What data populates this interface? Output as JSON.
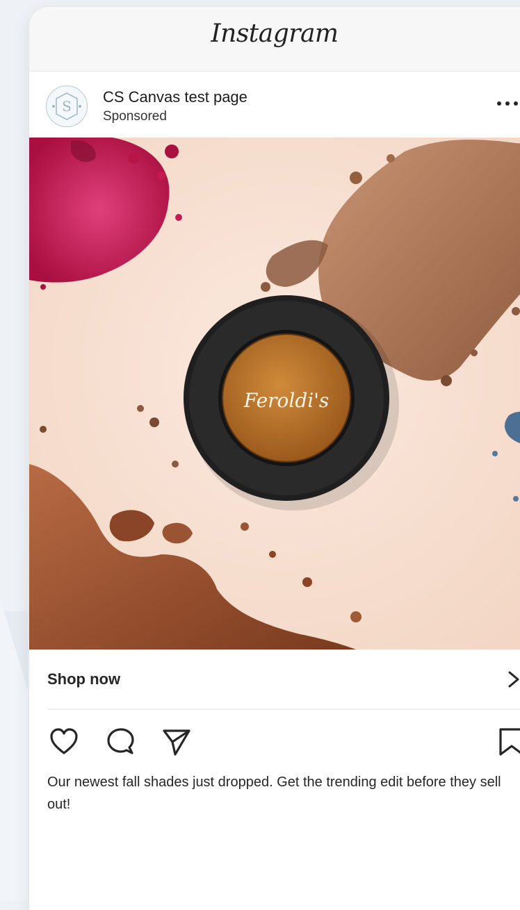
{
  "app": {
    "logo_text": "Instagram"
  },
  "post": {
    "page_name": "CS Canvas test page",
    "sponsored_label": "Sponsored",
    "avatar_letter": "S",
    "image_brand_text": "Feroldi's",
    "cta_label": "Shop now",
    "caption": "Our newest fall shades just dropped. Get the trending edit before they sell out!"
  },
  "icons": {
    "more": "more-icon",
    "chevron": "chevron-right-icon",
    "like": "heart-icon",
    "comment": "comment-icon",
    "share": "send-icon",
    "save": "bookmark-icon"
  },
  "colors": {
    "background": "#eef2f6",
    "image_background": "#f6e0d2",
    "pink_pigment": "#c8174f",
    "bronze_pigment": "#a0653f",
    "gold_pigment": "#b8732a"
  }
}
